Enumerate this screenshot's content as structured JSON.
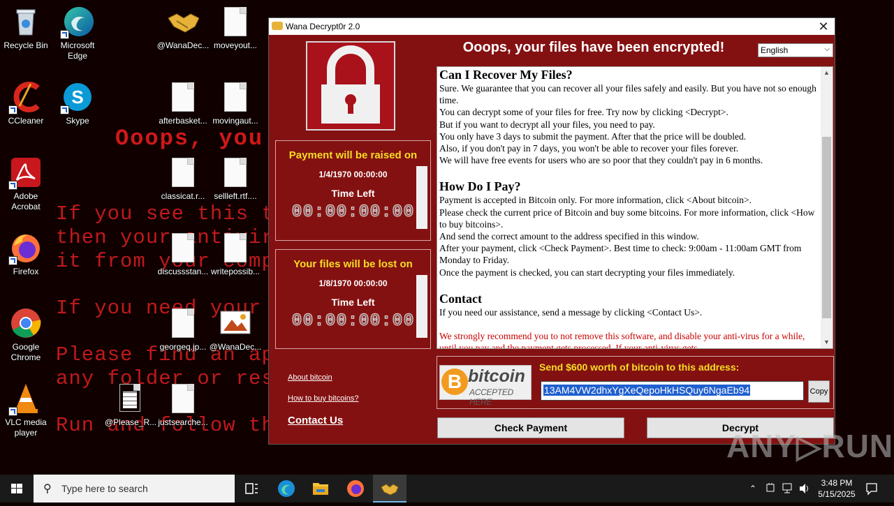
{
  "wallpaper": {
    "big": "Ooops, you",
    "lines": [
      "If you see this te",
      "then your antiviru",
      "it from your compu",
      "If you need your f",
      "Please find an app",
      "any folder or rest",
      "Run and follow the"
    ]
  },
  "desktop_icons": [
    {
      "label": "Recycle Bin",
      "icon": "recycle-bin-icon"
    },
    {
      "label": "Microsoft\nEdge",
      "icon": "edge-icon"
    },
    {
      "label": "@WanaDec...",
      "icon": "handshake-icon"
    },
    {
      "label": "moveyout...",
      "icon": "document-icon"
    },
    {
      "label": "CCleaner",
      "icon": "ccleaner-icon"
    },
    {
      "label": "Skype",
      "icon": "skype-icon"
    },
    {
      "label": "afterbasket...",
      "icon": "document-icon"
    },
    {
      "label": "movingaut...",
      "icon": "document-icon"
    },
    {
      "label": "Adobe\nAcrobat",
      "icon": "acrobat-icon"
    },
    {
      "label": "classicat.r...",
      "icon": "document-icon"
    },
    {
      "label": "sellleft.rtf....",
      "icon": "document-icon"
    },
    {
      "label": "Firefox",
      "icon": "firefox-icon"
    },
    {
      "label": "discussstan...",
      "icon": "document-icon"
    },
    {
      "label": "writepossib...",
      "icon": "document-icon"
    },
    {
      "label": "Google\nChrome",
      "icon": "chrome-icon"
    },
    {
      "label": "georgeq.jp...",
      "icon": "document-icon"
    },
    {
      "label": "@WanaDec...",
      "icon": "image-icon"
    },
    {
      "label": "VLC media\nplayer",
      "icon": "vlc-icon"
    },
    {
      "label": "@Please_R...",
      "icon": "text-document-icon"
    },
    {
      "label": "justsearche...",
      "icon": "document-icon"
    }
  ],
  "window": {
    "title": "Wana Decrypt0r 2.0",
    "close": "✕",
    "headline": "Ooops, your files have been encrypted!",
    "language": "English",
    "timer1": {
      "head": "Payment will be raised on",
      "date": "1/4/1970 00:00:00",
      "time_left": "Time Left",
      "digits": "00:00:00:00"
    },
    "timer2": {
      "head": "Your files will be lost on",
      "date": "1/8/1970 00:00:00",
      "time_left": "Time Left",
      "digits": "00:00:00:00"
    },
    "links": {
      "about": "About bitcoin",
      "howto": "How to buy bitcoins?",
      "contact": "Contact Us"
    },
    "message": {
      "h1": "Can I Recover My Files?",
      "p1": [
        "Sure. We guarantee that you can recover all your files safely and easily. But you have not so enough time.",
        "You can decrypt some of your files for free. Try now by clicking <Decrypt>.",
        "But if you want to decrypt all your files, you need to pay.",
        "You only have 3 days to submit the payment. After that the price will be doubled.",
        "Also, if you don't pay in 7 days, you won't be able to recover your files forever.",
        "We will have free events for users who are so poor that they couldn't pay in 6 months."
      ],
      "h2": "How Do I Pay?",
      "p2": [
        "Payment is accepted in Bitcoin only. For more information, click <About bitcoin>.",
        "Please check the current price of Bitcoin and buy some bitcoins. For more information, click <How to buy bitcoins>.",
        "And send the correct amount to the address specified in this window.",
        "After your payment, click <Check Payment>. Best time to check: 9:00am - 11:00am GMT from Monday to Friday.",
        "Once the payment is checked, you can start decrypting your files immediately."
      ],
      "h3": "Contact",
      "p3": "If you need our assistance, send a message by clicking <Contact Us>.",
      "warning": "We strongly recommend you to not remove this software, and disable your anti-virus for a while, until you pay and the payment gets processed. If your anti-virus gets"
    },
    "bitcoin": {
      "coin": "B",
      "word": "bitcoin",
      "accepted": "ACCEPTED HERE",
      "send": "Send $600 worth of bitcoin to this address:",
      "address": "13AM4VW2dhxYgXeQepoHkHSQuy6NgaEb94",
      "copy": "Copy"
    },
    "buttons": {
      "check": "Check Payment",
      "decrypt": "Decrypt"
    }
  },
  "watermark": "ANY▷RUN",
  "taskbar": {
    "search_placeholder": "Type here to search",
    "time": "3:48 PM",
    "date": "5/15/2025"
  }
}
